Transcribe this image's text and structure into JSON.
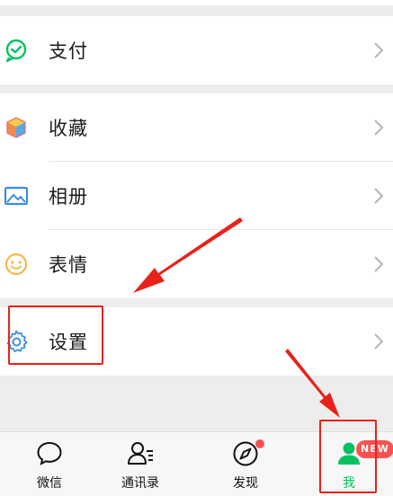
{
  "menu": {
    "pay": {
      "label": "支付",
      "icon": "pay-icon"
    },
    "favorites": {
      "label": "收藏",
      "icon": "favorites-cube-icon"
    },
    "album": {
      "label": "相册",
      "icon": "album-icon"
    },
    "stickers": {
      "label": "表情",
      "icon": "sticker-smile-icon"
    },
    "settings": {
      "label": "设置",
      "icon": "gear-icon"
    }
  },
  "tabbar": {
    "tabs": [
      {
        "label": "微信",
        "icon": "chat-bubble-icon"
      },
      {
        "label": "通讯录",
        "icon": "contacts-icon"
      },
      {
        "label": "发现",
        "icon": "compass-icon"
      },
      {
        "label": "我",
        "icon": "me-person-icon"
      }
    ],
    "badge": "NEW"
  },
  "colors": {
    "accent": "#07c160",
    "highlight": "#e8221a",
    "badge": "#fa5151"
  }
}
